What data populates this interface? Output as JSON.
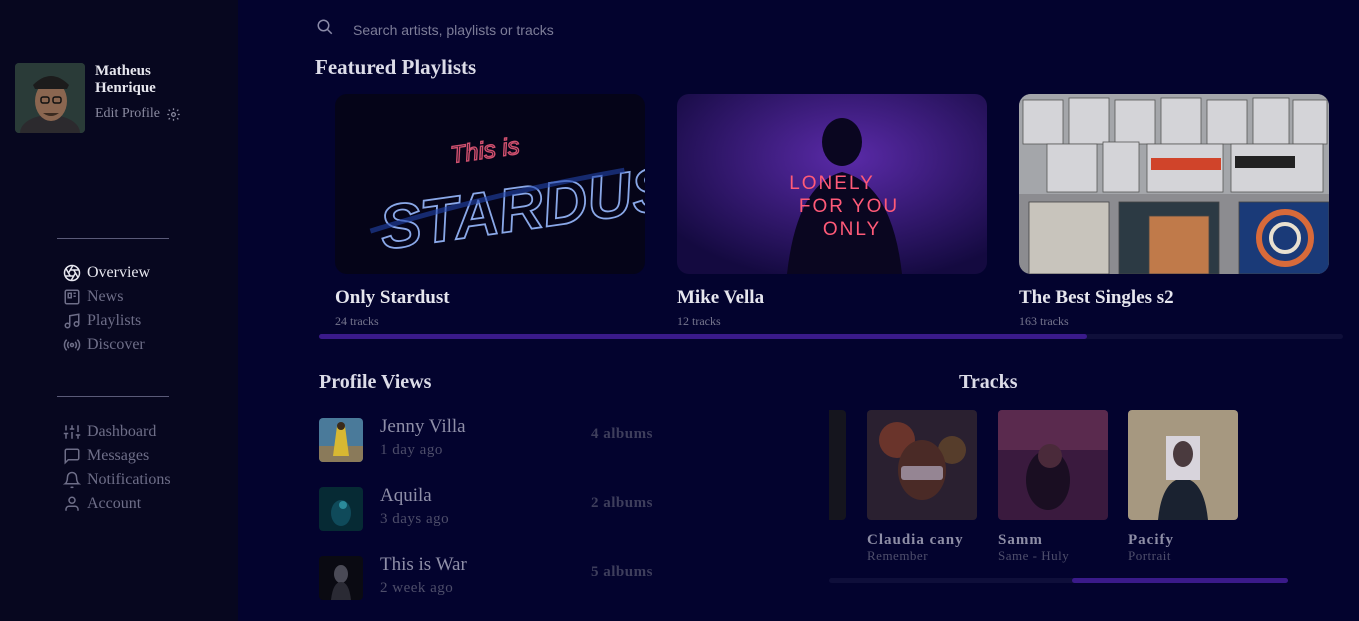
{
  "profile": {
    "name": "Matheus Henrique",
    "edit_label": "Edit Profile"
  },
  "nav_primary": [
    {
      "label": "Overview",
      "icon": "aperture-icon",
      "active": true
    },
    {
      "label": "News",
      "icon": "news-icon",
      "active": false
    },
    {
      "label": "Playlists",
      "icon": "music-note-icon",
      "active": false
    },
    {
      "label": "Discover",
      "icon": "broadcast-icon",
      "active": false
    }
  ],
  "nav_secondary": [
    {
      "label": "Dashboard",
      "icon": "sliders-icon"
    },
    {
      "label": "Messages",
      "icon": "message-icon"
    },
    {
      "label": "Notifications",
      "icon": "bell-icon"
    },
    {
      "label": "Account",
      "icon": "user-icon"
    }
  ],
  "search": {
    "placeholder": "Search artists, playlists or tracks"
  },
  "featured": {
    "title": "Featured Playlists",
    "playlists": [
      {
        "name": "Only Stardust",
        "tracks": "24 tracks",
        "cover_text_top": "This is",
        "cover_text_main": "STARDUST"
      },
      {
        "name": "Mike Vella",
        "tracks": "12 tracks",
        "cover_text_lines": [
          "LONELY",
          "FOR YOU",
          "ONLY"
        ]
      },
      {
        "name": "The Best Singles s2",
        "tracks": "163 tracks"
      }
    ],
    "scroll_position": 0.75
  },
  "profile_views": {
    "title": "Profile Views",
    "items": [
      {
        "name": "Jenny Villa",
        "time": "1 day ago",
        "albums": "4 albums"
      },
      {
        "name": "Aquila",
        "time": "3 days ago",
        "albums": "2 albums"
      },
      {
        "name": "This is War",
        "time": "2 week ago",
        "albums": "5 albums"
      }
    ]
  },
  "tracks": {
    "title": "Tracks",
    "items": [
      {
        "title": "Claudia cany",
        "subtitle": "Remember"
      },
      {
        "title": "Samm",
        "subtitle": "Same - Huly"
      },
      {
        "title": "Pacify",
        "subtitle": "Portrait"
      }
    ],
    "scroll_position": 0.53
  },
  "colors": {
    "background": "#03032e",
    "sidebar": "#07071f",
    "accent": "#3a1a8a"
  }
}
